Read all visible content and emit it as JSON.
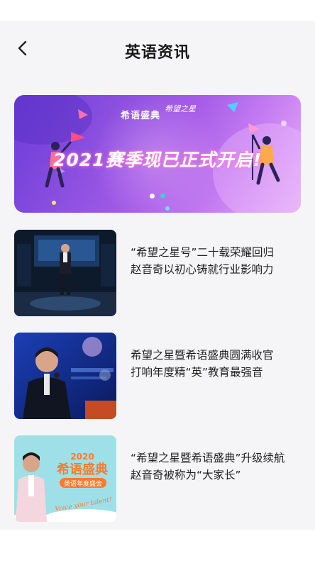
{
  "header": {
    "title": "英语资讯",
    "back_icon": "chevron-left-icon"
  },
  "banner": {
    "logo_text": "希语盛典",
    "logo_sub": "希望之星",
    "headline": "2021赛季现已正式开启!",
    "active_index": 0,
    "slide_count": 2
  },
  "news": [
    {
      "line1": "“希望之星号”二十载荣耀回归",
      "line2": "赵音奇以初心铸就行业影响力"
    },
    {
      "line1": "希望之星暨希语盛典圆满收官",
      "line2": "打响年度精“英”教育最强音"
    },
    {
      "line1": "“希望之星暨希语盛典”升级续航",
      "line2": "赵音奇被称为“大家长”"
    }
  ],
  "thumb3": {
    "year": "2020",
    "brand": "希语盛典",
    "sub": "英语年度盛会",
    "script": "Voice your talent!"
  },
  "colors": {
    "accent": "#8b4fe0",
    "background": "#f5f5f8",
    "title": "#1a1a1a"
  }
}
